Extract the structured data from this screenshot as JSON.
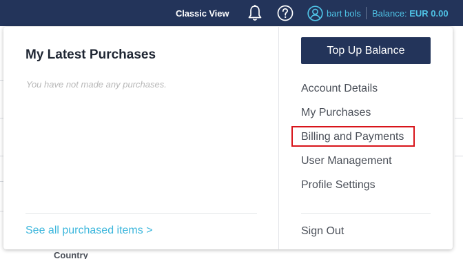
{
  "topbar": {
    "classic_view": "Classic View",
    "bell_icon": "bell-icon",
    "help_icon": "help-icon",
    "user_icon": "user-avatar-icon",
    "username": "bart bols",
    "balance_label": "Balance:",
    "balance_value": "EUR 0.00"
  },
  "purchases": {
    "title": "My Latest Purchases",
    "empty_message": "You have not made any purchases.",
    "see_all_link": "See all purchased items >"
  },
  "account_menu": {
    "topup_button": "Top Up Balance",
    "items": [
      {
        "label": "Account Details"
      },
      {
        "label": "My Purchases"
      },
      {
        "label": "Billing and Payments",
        "highlighted": true
      },
      {
        "label": "User Management"
      },
      {
        "label": "Profile Settings"
      }
    ],
    "sign_out": "Sign Out"
  },
  "background_page": {
    "country_label": "Country"
  },
  "colors": {
    "navbar": "#23345a",
    "accent": "#3bb6dc",
    "highlight_border": "#d8141a"
  }
}
